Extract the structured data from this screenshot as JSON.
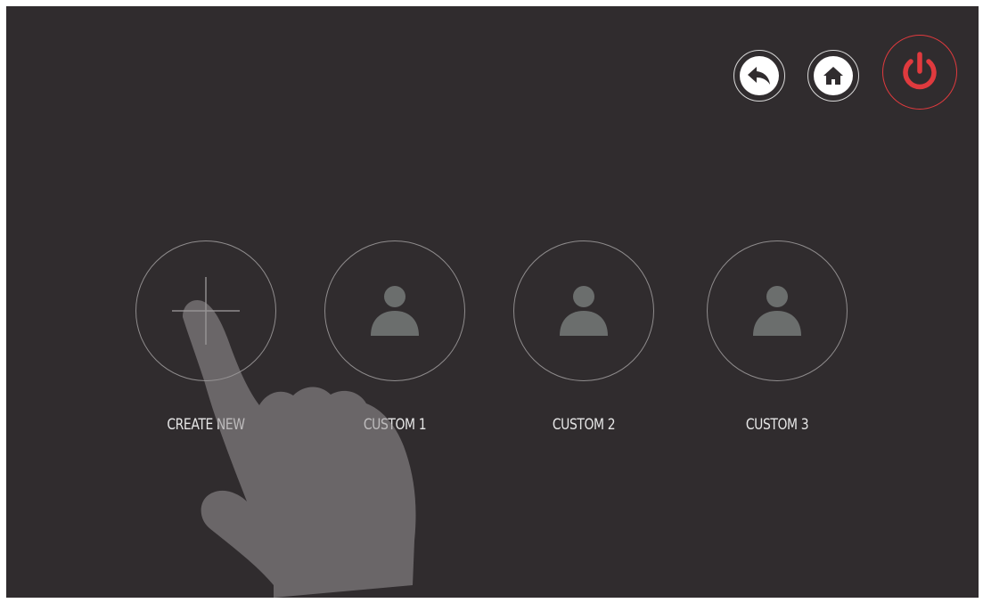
{
  "toolbar": {
    "back_icon": "back-arrow-icon",
    "home_icon": "home-icon",
    "power_icon": "power-icon",
    "power_color": "#e03a3e"
  },
  "profiles": [
    {
      "label": "CREATE NEW",
      "icon": "plus-icon"
    },
    {
      "label": "CUSTOM 1",
      "icon": "user-icon"
    },
    {
      "label": "CUSTOM 2",
      "icon": "user-icon"
    },
    {
      "label": "CUSTOM 3",
      "icon": "user-icon"
    }
  ],
  "colors": {
    "background": "#302c2e",
    "circle_border": "#8f8c8d",
    "user_icon": "#6b6e6d",
    "label": "#e6e6e6"
  }
}
